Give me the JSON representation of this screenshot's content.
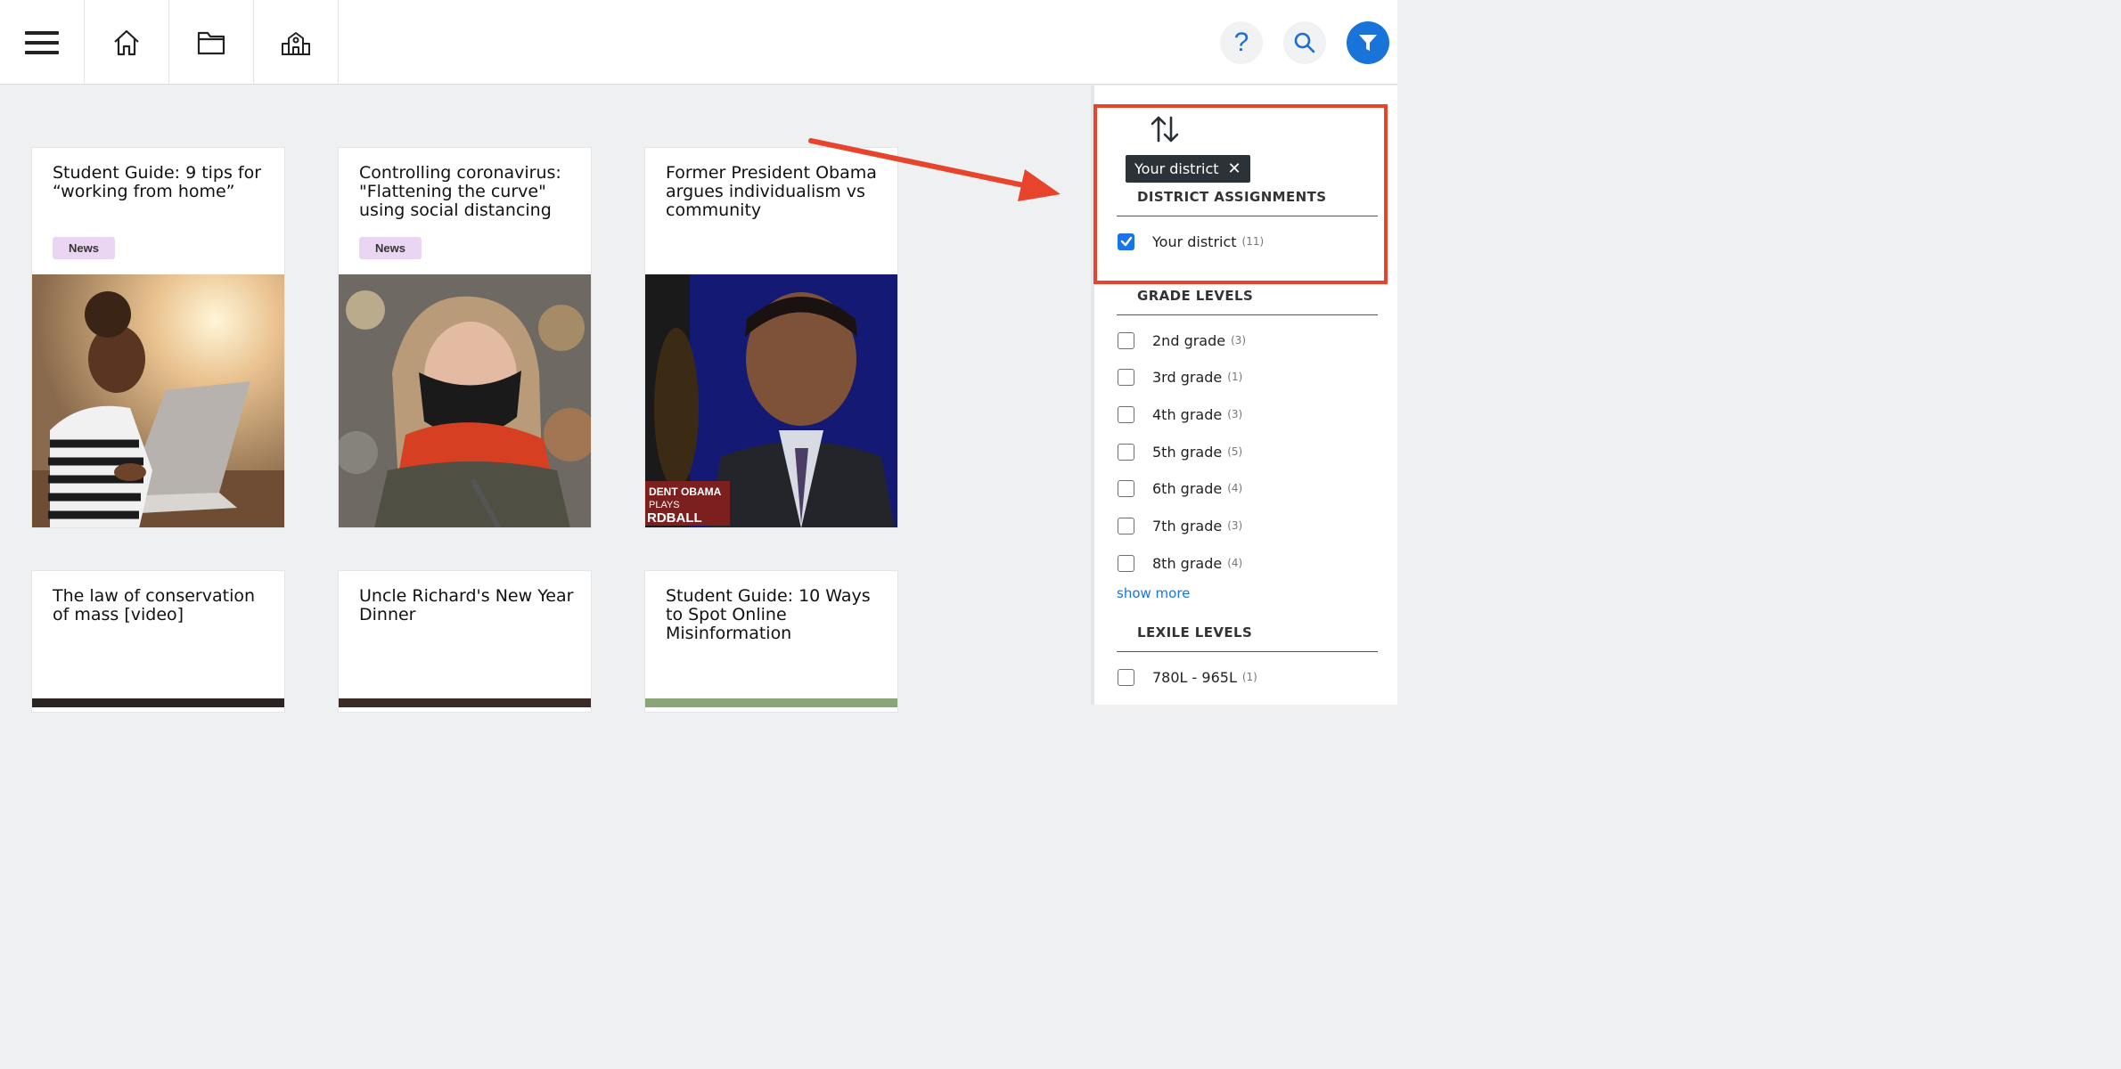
{
  "nav": {
    "icons": [
      "menu-icon",
      "home-icon",
      "folder-icon",
      "school-icon"
    ],
    "right_icons": [
      "help-icon",
      "search-icon",
      "filter-icon"
    ],
    "help_glyph": "?"
  },
  "cards": [
    {
      "title": "Student Guide: 9 tips for “working from home”",
      "badge": "News"
    },
    {
      "title": "Controlling coronavirus: \"Flattening the curve\" using social distancing",
      "badge": "News"
    },
    {
      "title": "Former President Obama argues individualism vs community",
      "badge": ""
    },
    {
      "title": "The law of conservation of mass [video]",
      "badge": ""
    },
    {
      "title": "Uncle Richard's New Year Dinner",
      "badge": ""
    },
    {
      "title": "Student Guide: 10 Ways to Spot Online Misinformation",
      "badge": ""
    }
  ],
  "filters": {
    "active_chip": {
      "label": "Your district",
      "remove": "✕"
    },
    "district": {
      "title": "DISTRICT ASSIGNMENTS",
      "options": [
        {
          "label": "Your district",
          "count": "(11)",
          "checked": true
        }
      ]
    },
    "grades": {
      "title": "GRADE LEVELS",
      "options": [
        {
          "label": "2nd grade",
          "count": "(3)"
        },
        {
          "label": "3rd grade",
          "count": "(1)"
        },
        {
          "label": "4th grade",
          "count": "(3)"
        },
        {
          "label": "5th grade",
          "count": "(5)"
        },
        {
          "label": "6th grade",
          "count": "(4)"
        },
        {
          "label": "7th grade",
          "count": "(3)"
        },
        {
          "label": "8th grade",
          "count": "(4)"
        }
      ],
      "show_more": "show more"
    },
    "lexile": {
      "title": "LEXILE LEVELS",
      "options": [
        {
          "label": "780L - 965L",
          "count": "(1)"
        }
      ]
    }
  },
  "colors": {
    "accent": "#1a73e8",
    "annotation": "#e8432b",
    "chip_bg": "#2c3338",
    "badge_bg": "#ead6f2"
  }
}
